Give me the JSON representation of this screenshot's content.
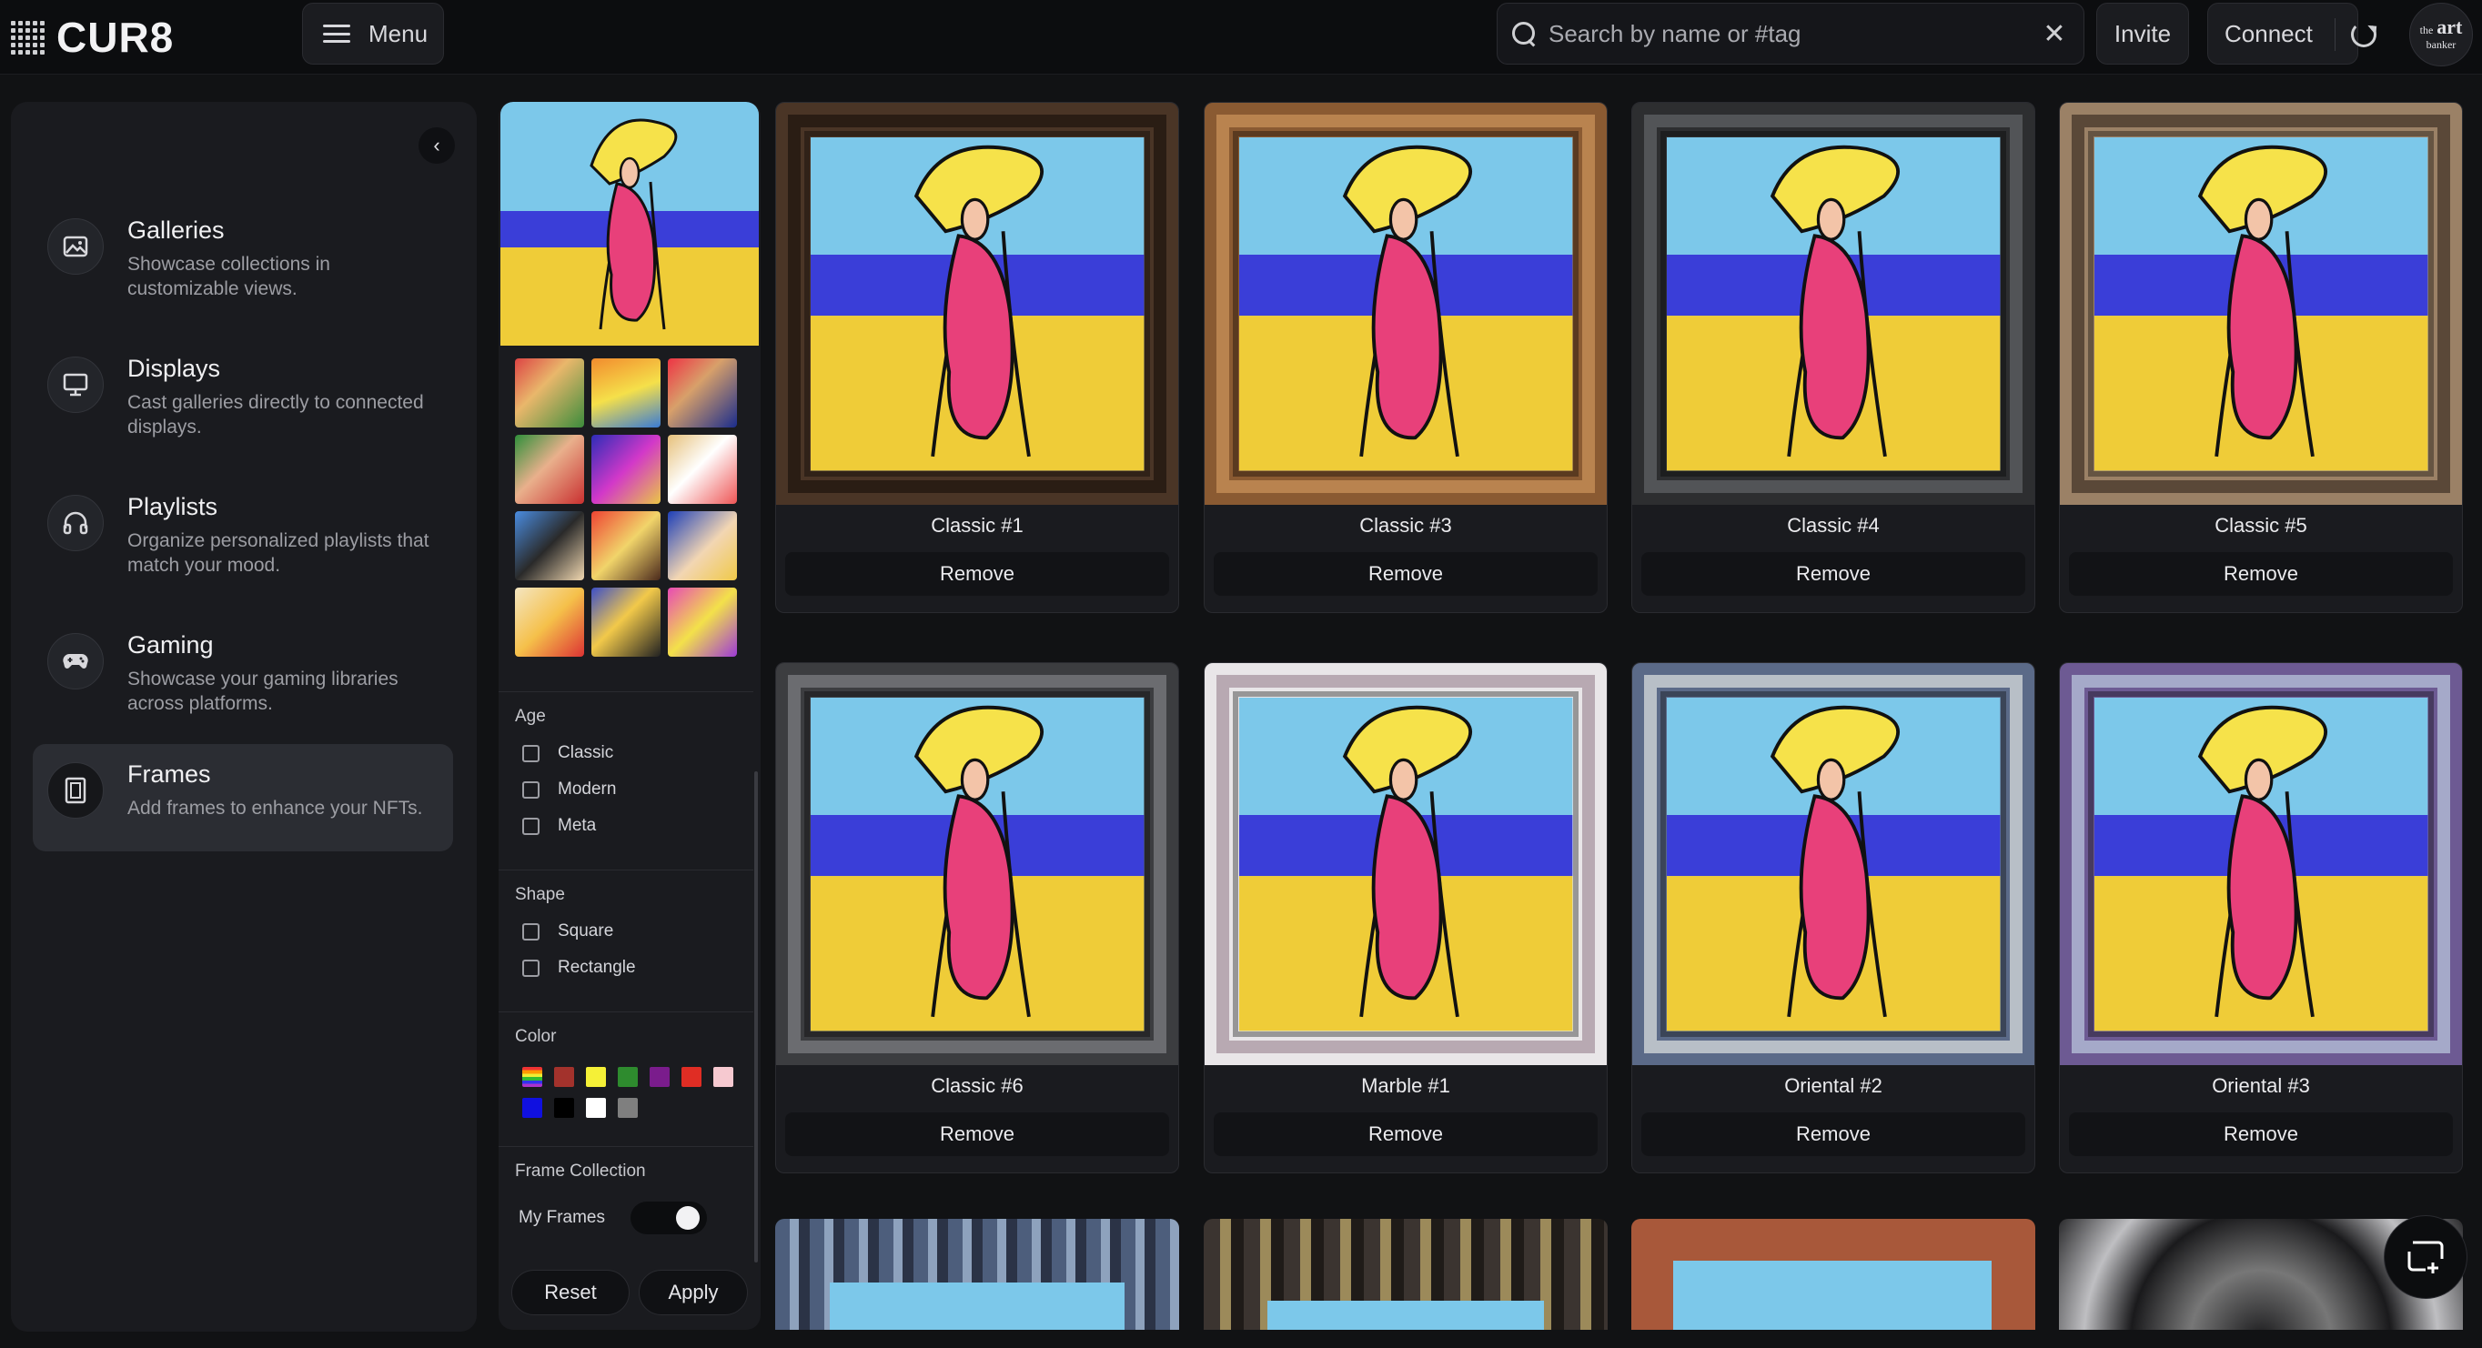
{
  "app": {
    "brand": "CUR8",
    "avatar_line1": "the",
    "avatar_line2": "art",
    "avatar_line3": "banker"
  },
  "header": {
    "menu_label": "Menu",
    "search_placeholder": "Search by name or #tag",
    "invite_label": "Invite",
    "connect_label": "Connect"
  },
  "sidebar": {
    "items": [
      {
        "title": "Galleries",
        "desc": "Showcase collections in customizable views.",
        "icon": "image-icon"
      },
      {
        "title": "Displays",
        "desc": "Cast galleries directly to connected displays.",
        "icon": "monitor-icon"
      },
      {
        "title": "Playlists",
        "desc": "Organize personalized playlists that match your mood.",
        "icon": "headphones-icon"
      },
      {
        "title": "Gaming",
        "desc": "Showcase your gaming libraries across platforms.",
        "icon": "gamepad-icon"
      },
      {
        "title": "Frames",
        "desc": "Add frames to enhance your NFTs.",
        "icon": "frame-icon",
        "active": true
      }
    ]
  },
  "filters": {
    "age": {
      "title": "Age",
      "options": [
        "Classic",
        "Modern",
        "Meta"
      ]
    },
    "shape": {
      "title": "Shape",
      "options": [
        "Square",
        "Rectangle"
      ]
    },
    "color": {
      "title": "Color",
      "swatches": [
        "rainbow",
        "#a3322c",
        "#f5f037",
        "#2e8b2e",
        "#7a1c8c",
        "#e02d24",
        "#f6c9d0",
        "#1010e0",
        "#000000",
        "#ffffff",
        "#7f7f7f"
      ]
    },
    "collection": {
      "title": "Frame Collection",
      "toggle_label": "My Frames",
      "toggle_on": true
    },
    "reset_label": "Reset",
    "apply_label": "Apply"
  },
  "frames": [
    {
      "name": "Classic #1",
      "action": "Remove",
      "frame": "#4a3526",
      "inner": "#2a1d14"
    },
    {
      "name": "Classic #3",
      "action": "Remove",
      "frame": "#8a5a32",
      "inner": "#b9834f"
    },
    {
      "name": "Classic #4",
      "action": "Remove",
      "frame": "#2d2e30",
      "inner": "#525457"
    },
    {
      "name": "Classic #5",
      "action": "Remove",
      "frame": "#9b8166",
      "inner": "#5a4838"
    },
    {
      "name": "Classic #6",
      "action": "Remove",
      "frame": "#3c3d40",
      "inner": "#6b6c70"
    },
    {
      "name": "Marble #1",
      "action": "Remove",
      "frame": "#e9e6e8",
      "inner": "#b8a9b2"
    },
    {
      "name": "Oriental #2",
      "action": "Remove",
      "frame": "#5b6a88",
      "inner": "#b8bfc7"
    },
    {
      "name": "Oriental #3",
      "action": "Remove",
      "frame": "#6d5a93",
      "inner": "#a5a9c9"
    }
  ]
}
